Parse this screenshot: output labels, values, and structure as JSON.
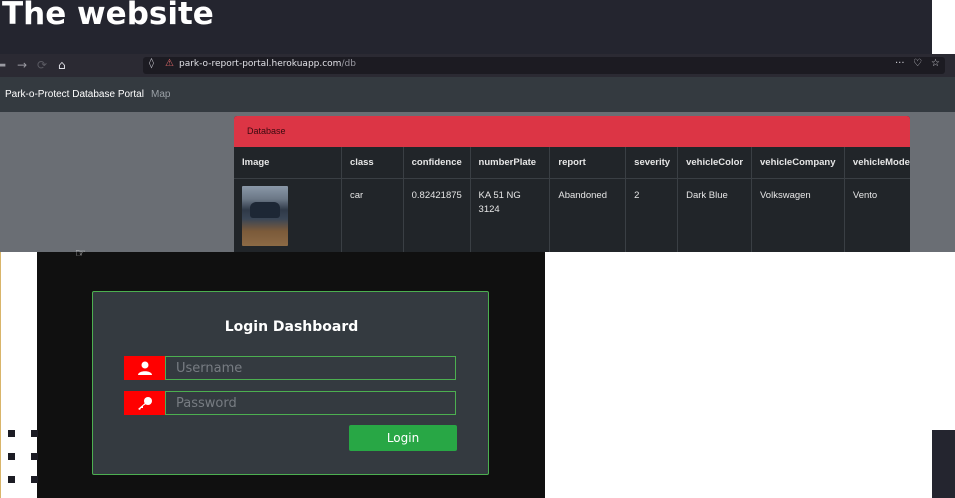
{
  "slide": {
    "title": "The website"
  },
  "browser": {
    "url_host": "park-o-report-portal.herokuapp.com",
    "url_path": "/db",
    "brand": "Park-o-Protect Database Portal",
    "nav_map": "Map"
  },
  "database": {
    "card_title": "Database",
    "columns": [
      "Image",
      "class",
      "confidence",
      "numberPlate",
      "report",
      "severity",
      "vehicleColor",
      "vehicleCompany",
      "vehicleMode"
    ],
    "rows": [
      {
        "class": "car",
        "confidence": "0.82421875",
        "numberPlate": "KA 51 NG 3124",
        "report": "Abandoned",
        "severity": "2",
        "vehicleColor": "Dark Blue",
        "vehicleCompany": "Volkswagen",
        "vehicleModel": "Vento"
      }
    ]
  },
  "login": {
    "title": "Login Dashboard",
    "username_placeholder": "Username",
    "password_placeholder": "Password",
    "button_label": "Login"
  },
  "colors": {
    "header_red": "#dc3545",
    "login_green": "#28a745",
    "icon_red": "#ff0000",
    "banner_dark": "#24252f"
  }
}
